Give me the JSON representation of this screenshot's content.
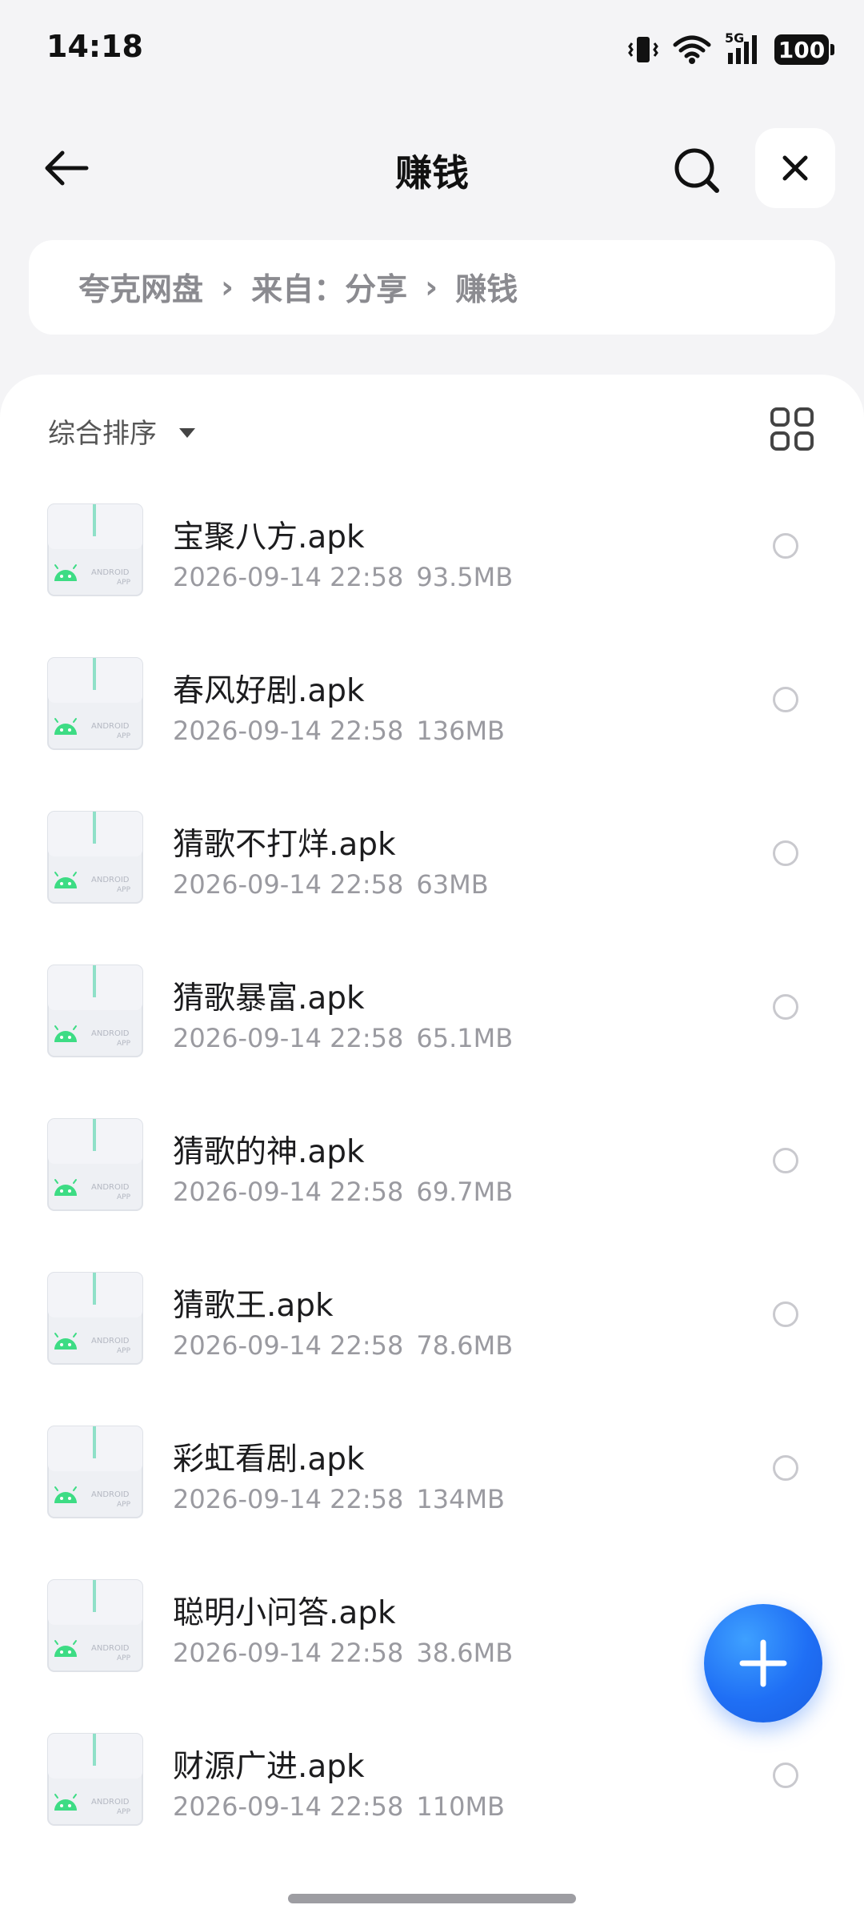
{
  "status_bar": {
    "time": "14:18",
    "network": "5G",
    "battery": "100"
  },
  "header": {
    "title": "赚钱"
  },
  "breadcrumb": [
    "夸克网盘",
    "来自：分享",
    "赚钱"
  ],
  "sort": {
    "label": "综合排序"
  },
  "files": [
    {
      "name": "宝聚八方.apk",
      "date": "2026-09-14 22:58",
      "size": "93.5MB"
    },
    {
      "name": "春风好剧.apk",
      "date": "2026-09-14 22:58",
      "size": "136MB"
    },
    {
      "name": "猜歌不打烊.apk",
      "date": "2026-09-14 22:58",
      "size": "63MB"
    },
    {
      "name": "猜歌暴富.apk",
      "date": "2026-09-14 22:58",
      "size": "65.1MB"
    },
    {
      "name": "猜歌的神.apk",
      "date": "2026-09-14 22:58",
      "size": "69.7MB"
    },
    {
      "name": "猜歌王.apk",
      "date": "2026-09-14 22:58",
      "size": "78.6MB"
    },
    {
      "name": "彩虹看剧.apk",
      "date": "2026-09-14 22:58",
      "size": "134MB"
    },
    {
      "name": "聪明小问答.apk",
      "date": "2026-09-14 22:58",
      "size": "38.6MB"
    },
    {
      "name": "财源广进.apk",
      "date": "2026-09-14 22:58",
      "size": "110MB"
    }
  ],
  "file_icon": {
    "line1": "ANDROID",
    "line2": "APP"
  },
  "colors": {
    "accent": "#1f6ff5",
    "android_green": "#3ddc84",
    "background": "#f4f4f6"
  }
}
